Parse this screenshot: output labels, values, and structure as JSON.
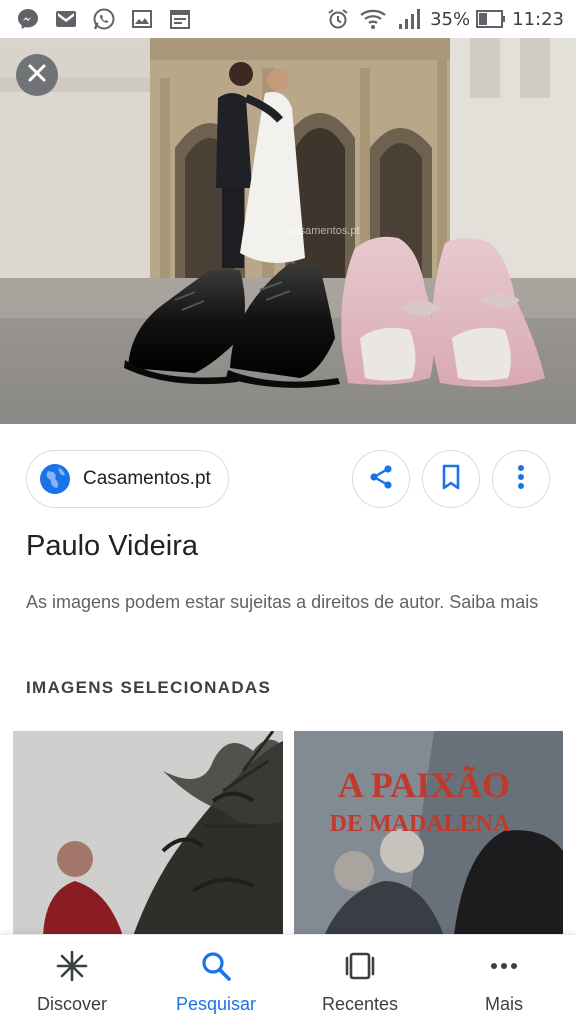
{
  "status_bar": {
    "battery_percent": "35%",
    "time": "11:23",
    "notification_icons": [
      "messenger-icon",
      "gmail-icon",
      "whatsapp-icon",
      "gallery-icon",
      "calendar-icon"
    ],
    "system_icons": [
      "alarm-icon",
      "wifi-icon",
      "signal-icon",
      "battery-icon"
    ]
  },
  "hero": {
    "watermark": "casamentos.pt"
  },
  "source": {
    "site_name": "Casamentos.pt",
    "icon": "globe-icon"
  },
  "actions": [
    "share-icon",
    "bookmark-icon",
    "more-vert-icon"
  ],
  "title": "Paulo Videira",
  "copyright_notice": "As imagens podem estar sujeitas a direitos de autor. Saiba mais",
  "section": {
    "header": "IMAGENS SELECIONADAS"
  },
  "thumbnails": [
    {
      "caption": ""
    },
    {
      "line1": "A PAIXÃO",
      "line2": "DE MADALENA"
    }
  ],
  "bottom_nav": {
    "items": [
      {
        "label": "Discover",
        "icon": "discover-icon",
        "active": false
      },
      {
        "label": "Pesquisar",
        "icon": "search-icon",
        "active": true
      },
      {
        "label": "Recentes",
        "icon": "recents-icon",
        "active": false
      },
      {
        "label": "Mais",
        "icon": "more-horiz-icon",
        "active": false
      }
    ]
  },
  "colors": {
    "accent": "#1a73e8",
    "text_primary": "#202124",
    "text_secondary": "#5f6368",
    "chip_border": "#dadce0",
    "thumb_title_red": "#c0392b"
  }
}
